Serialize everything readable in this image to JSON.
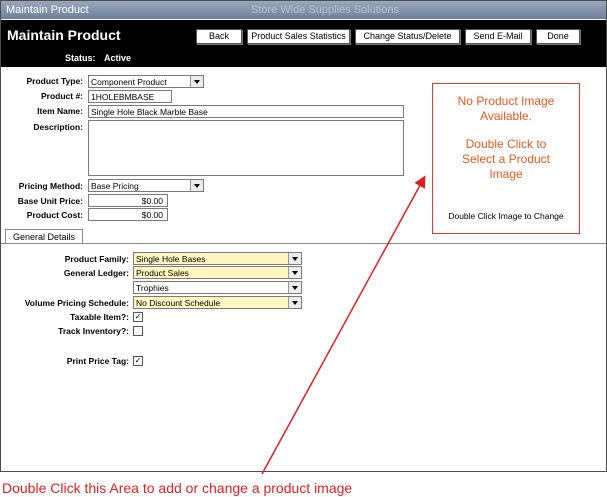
{
  "window": {
    "title": "Maintain Product",
    "ghost_title": "Store Wide Supplies Solutions"
  },
  "header": {
    "title": "Maintain Product",
    "status_label": "Status:",
    "status_value": "Active",
    "buttons": {
      "back": "Back",
      "product_sales_statistics": "Product Sales Statistics",
      "change_status_delete": "Change Status/Delete",
      "send_email": "Send E-Mail",
      "done": "Done"
    }
  },
  "form": {
    "product_type": {
      "label": "Product Type:",
      "value": "Component Product"
    },
    "product_number": {
      "label": "Product #:",
      "value": "1HOLEBMBASE"
    },
    "item_name": {
      "label": "Item Name:",
      "value": "Single Hole Black Marble Base"
    },
    "description": {
      "label": "Description:",
      "value": ""
    },
    "pricing_method": {
      "label": "Pricing Method:",
      "value": "Base Pricing"
    },
    "base_unit_price": {
      "label": "Base Unit Price:",
      "value": "$0.00"
    },
    "product_cost": {
      "label": "Product Cost:",
      "value": "$0.00"
    }
  },
  "image_box": {
    "line1": "No Product Image",
    "line2": "Available.",
    "line3": "Double Click to",
    "line4": "Select a Product",
    "line5": "Image",
    "hint": "Double Click Image to Change"
  },
  "tabs": {
    "general_details": "General Details"
  },
  "general": {
    "product_family": {
      "label": "Product Family:",
      "value": "Single Hole Bases"
    },
    "general_ledger": {
      "label": "General Ledger:",
      "value": "Product Sales",
      "value2": "Trophies"
    },
    "volume_pricing": {
      "label": "Volume Pricing Schedule:",
      "value": "No Discount Schedule"
    },
    "taxable_item": {
      "label": "Taxable Item?:",
      "checked": true,
      "mark": "✓"
    },
    "track_inventory": {
      "label": "Track Inventory?:",
      "checked": false
    },
    "print_price_tag": {
      "label": "Print Price Tag:",
      "checked": true,
      "mark": "✓"
    }
  },
  "annotation": {
    "caption": "Double Click this Area to add or change a product image",
    "color": "#e01f1f"
  },
  "colors": {
    "header_bg": "#000000",
    "yellow_field": "#fff6c2",
    "image_message": "#e8591a"
  }
}
